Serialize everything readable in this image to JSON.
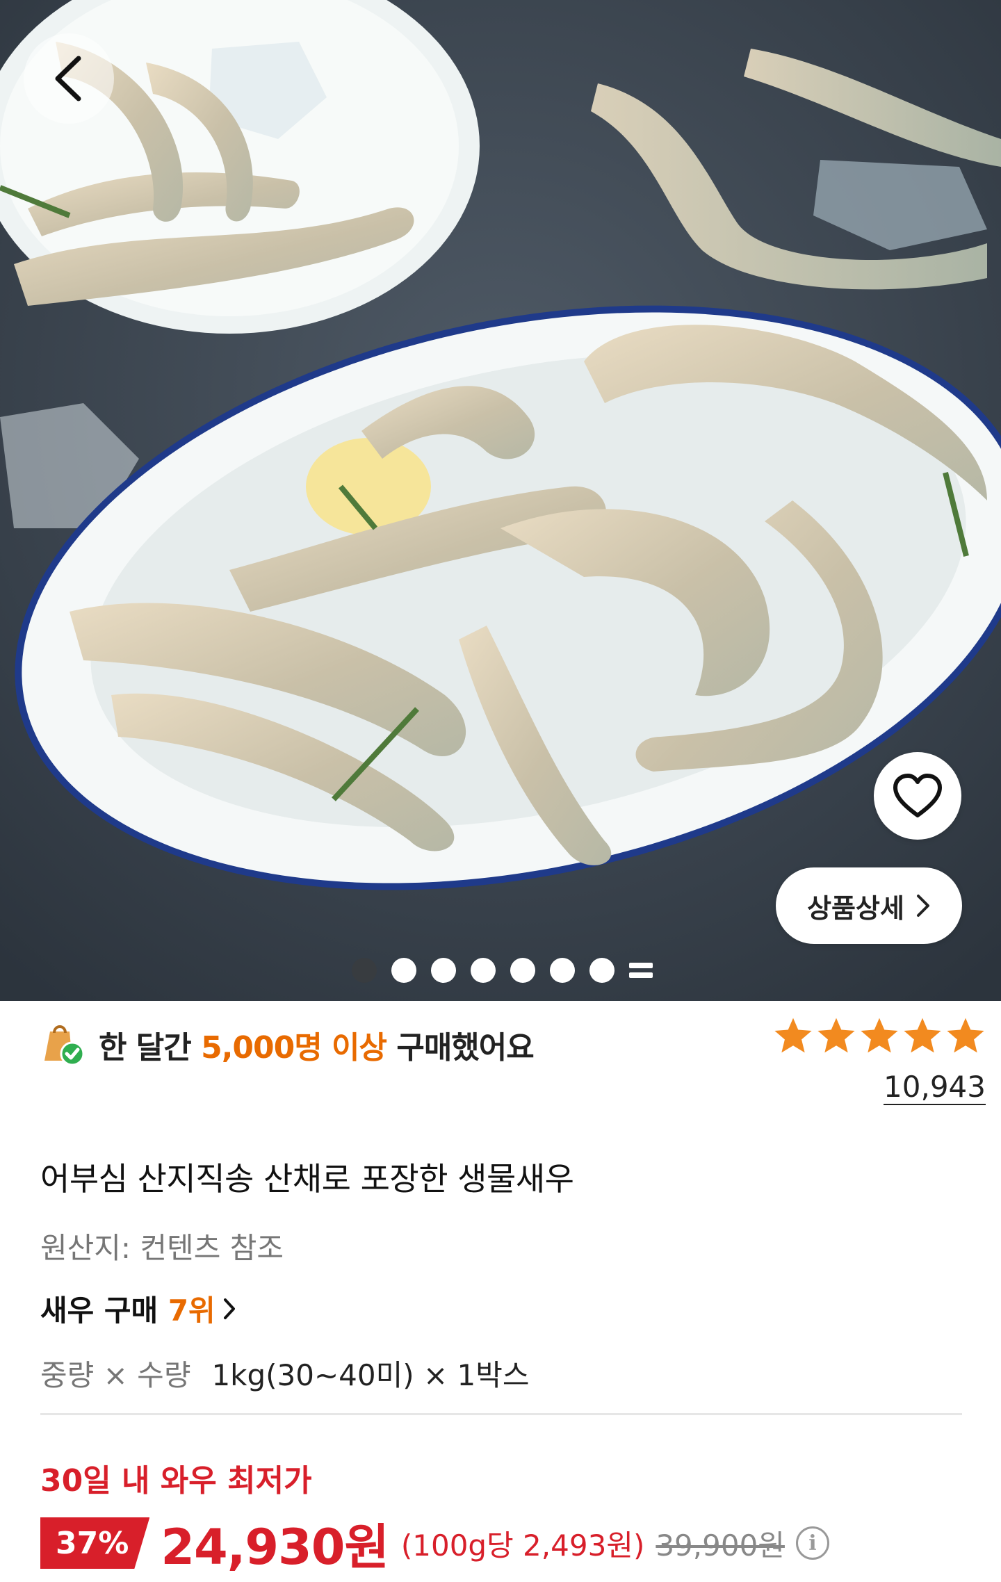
{
  "hero": {
    "image_subject": "Fresh raw shrimp on white oval plates over ice",
    "detail_button_label": "상품상세",
    "carousel": {
      "total_dots": 7,
      "active_index": 0
    }
  },
  "purchase_info": {
    "prefix": "한 달간 ",
    "highlight": "5,000명 이상",
    "suffix": " 구매했어요"
  },
  "rating": {
    "stars": 5,
    "review_count": "10,943"
  },
  "product": {
    "title": "어부심 산지직송 산채로 포장한 생물새우",
    "origin": "원산지: 컨텐츠 참조",
    "rank_label": "새우 구매 ",
    "rank_value": "7위",
    "spec_key": "중량 × 수량",
    "spec_value": "1kg(30~40미) × 1박스"
  },
  "price": {
    "lowest_label": "30일 내 와우 최저가",
    "discount": "37%",
    "sale_price": "24,930원",
    "unit_price": "(100g당 2,493원)",
    "original_price": "39,900원"
  },
  "colors": {
    "accent_orange": "#e86a00",
    "price_red": "#d81f2a",
    "star": "#f28a1f"
  }
}
